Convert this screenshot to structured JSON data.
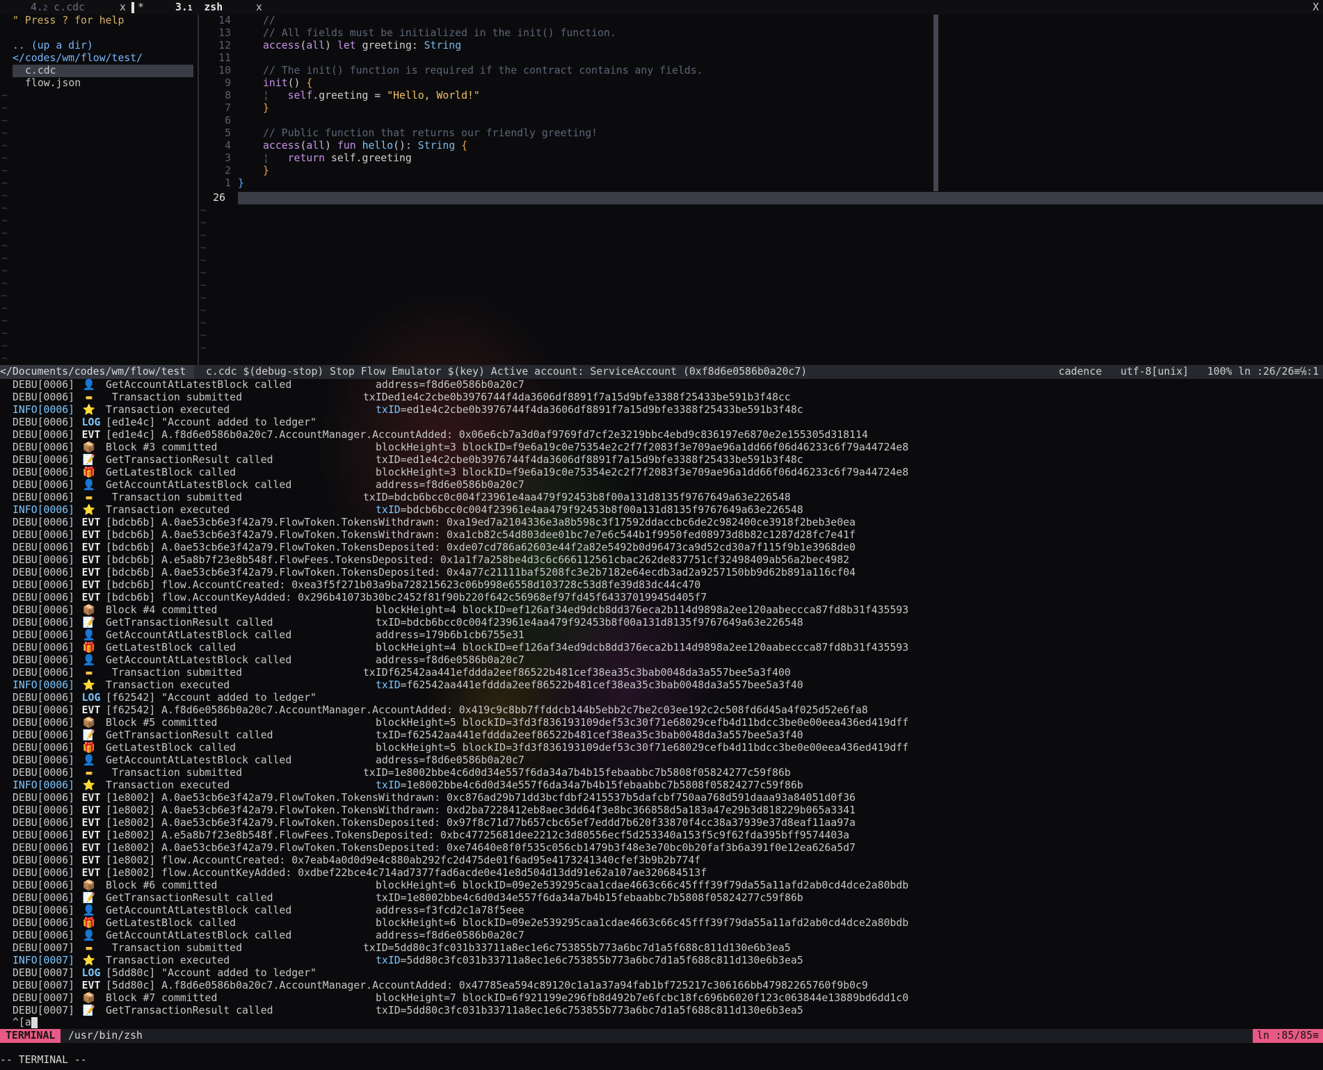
{
  "tabline": {
    "tabs": [
      {
        "num": "4.",
        "sub": "2",
        "label": "c.cdc",
        "close": "x",
        "active": false
      },
      {
        "num": "3.",
        "sub": "1",
        "label": "zsh",
        "close": "x",
        "active": true
      }
    ],
    "modified_marker": "*",
    "right_close": "X"
  },
  "nerdtree": {
    "help": "\" Press ? for help",
    "up_dir": ".. (up a dir)",
    "root": "</codes/wm/flow/test/",
    "files": [
      "c.cdc",
      "flow.json"
    ],
    "tilde": "~"
  },
  "editor": {
    "lines": [
      {
        "n": "14",
        "text": "//"
      },
      {
        "n": "13",
        "text": "// All fields must be initialized in the init() function."
      },
      {
        "n": "12",
        "text": "access(all) let greeting: String"
      },
      {
        "n": "11",
        "text": ""
      },
      {
        "n": "10",
        "text": "// The init() function is required if the contract contains any fields."
      },
      {
        "n": "9",
        "text": "init() {"
      },
      {
        "n": "8",
        "text": "self.greeting = \"Hello, World!\""
      },
      {
        "n": "7",
        "text": "}"
      },
      {
        "n": "6",
        "text": ""
      },
      {
        "n": "5",
        "text": "// Public function that returns our friendly greeting!"
      },
      {
        "n": "4",
        "text": "access(all) fun hello(): String {"
      },
      {
        "n": "3",
        "text": "return self.greeting"
      },
      {
        "n": "2",
        "text": "}"
      },
      {
        "n": "1",
        "text": "}"
      }
    ],
    "current_line": "26"
  },
  "statusline": {
    "left": "</Documents/codes/wm/flow/test",
    "file": "c.cdc",
    "middle": "$(debug-stop) Stop Flow Emulator $(key) Active account: ServiceAccount (0xf8d6e0586b0a20c7)",
    "filetype": "cadence",
    "encoding": "utf-8[unix]",
    "percent": "100%",
    "position": "ln :26/26≡℅:1"
  },
  "log": [
    {
      "lvl": "DEBU[0006]",
      "ic": "👤",
      "icc": "blue",
      "msg": "GetAccountAtLatestBlock called",
      "det": "address=f8d6e0586b0a20c7"
    },
    {
      "lvl": "DEBU[0006]",
      "ic": "▬",
      "icc": "yellow",
      "msg": " Transaction submitted",
      "det": "txIDed1e4c2cbe0b3976744f4da3606df8891f7a15d9bfe3388f25433be591b3f48cc",
      "sub": true
    },
    {
      "lvl": "INFO[0006]",
      "ic": "⭐",
      "icc": "yellow",
      "msg": "Transaction executed",
      "det": "txID=ed1e4c2cbe0b3976744f4da3606df8891f7a15d9bfe3388f25433be591b3f48c",
      "hl": true
    },
    {
      "lvl": "DEBU[0006]",
      "tag": "LOG",
      "msg": "[ed1e4c] \"Account added to ledger\""
    },
    {
      "lvl": "DEBU[0006]",
      "tag": "EVT",
      "msg": "[ed1e4c] A.f8d6e0586b0a20c7.AccountManager.AccountAdded: 0x06e6cb7a3d0af9769fd7cf2e3219bbc4ebd9c836197e6870e2e155305d318114"
    },
    {
      "lvl": "DEBU[0006]",
      "ic": "📦",
      "icc": "brown",
      "msg": "Block #3 committed",
      "det": "blockHeight=3 blockID=f9e6a19c0e75354e2c2f7f2083f3e709ae96a1dd66f06d46233c6f79a44724e8"
    },
    {
      "lvl": "DEBU[0006]",
      "ic": "📝",
      "icc": "white",
      "msg": "GetTransactionResult called",
      "det": "txID=ed1e4c2cbe0b3976744f4da3606df8891f7a15d9bfe3388f25433be591b3f48c"
    },
    {
      "lvl": "DEBU[0006]",
      "ic": "🎁",
      "icc": "cyan",
      "msg": "GetLatestBlock called",
      "det": "blockHeight=3 blockID=f9e6a19c0e75354e2c2f7f2083f3e709ae96a1dd66f06d46233c6f79a44724e8"
    },
    {
      "lvl": "DEBU[0006]",
      "ic": "👤",
      "icc": "blue",
      "msg": "GetAccountAtLatestBlock called",
      "det": "address=f8d6e0586b0a20c7"
    },
    {
      "lvl": "DEBU[0006]",
      "ic": "▬",
      "icc": "yellow",
      "msg": " Transaction submitted",
      "det": "txID=bdcb6bcc0c004f23961e4aa479f92453b8f00a131d8135f9767649a63e226548",
      "sub": true
    },
    {
      "lvl": "INFO[0006]",
      "ic": "⭐",
      "icc": "yellow",
      "msg": "Transaction executed",
      "det": "txID=bdcb6bcc0c004f23961e4aa479f92453b8f00a131d8135f9767649a63e226548",
      "hl": true
    },
    {
      "lvl": "DEBU[0006]",
      "tag": "EVT",
      "msg": "[bdcb6b] A.0ae53cb6e3f42a79.FlowToken.TokensWithdrawn: 0xa19ed7a2104336e3a8b598c3f17592ddaccbc6de2c982400ce3918f2beb3e0ea"
    },
    {
      "lvl": "DEBU[0006]",
      "tag": "EVT",
      "msg": "[bdcb6b] A.0ae53cb6e3f42a79.FlowToken.TokensWithdrawn: 0xa1cb82c54d803dee01bc7e7e6c544b1f9950fed08973d8b82c1287d28fc7e41f"
    },
    {
      "lvl": "DEBU[0006]",
      "tag": "EVT",
      "msg": "[bdcb6b] A.0ae53cb6e3f42a79.FlowToken.TokensDeposited: 0xde07cd786a62603e44f2a82e5492b0d96473ca9d52cd30a7f115f9b1e3968de0"
    },
    {
      "lvl": "DEBU[0006]",
      "tag": "EVT",
      "msg": "[bdcb6b] A.e5a8b7f23e8b548f.FlowFees.TokensDeposited: 0x1a1f7a258be4d3c6c666112561cbac262de837751cf32498409ab56a2bec4982"
    },
    {
      "lvl": "DEBU[0006]",
      "tag": "EVT",
      "msg": "[bdcb6b] A.0ae53cb6e3f42a79.FlowToken.TokensDeposited: 0x4a77c21111baf5208fc3e2b7182e64ecdb3ad2a9257150bb9d62b891a116cf04"
    },
    {
      "lvl": "DEBU[0006]",
      "tag": "EVT",
      "msg": "[bdcb6b] flow.AccountCreated: 0xea3f5f271b03a9ba728215623c06b998e6558d103728c53d8fe39d83dc44c470"
    },
    {
      "lvl": "DEBU[0006]",
      "tag": "EVT",
      "msg": "[bdcb6b] flow.AccountKeyAdded: 0x296b41073b30bc2452f81f90b220f642c56968ef97fd45f64337019945d405f7"
    },
    {
      "lvl": "DEBU[0006]",
      "ic": "📦",
      "icc": "brown",
      "msg": "Block #4 committed",
      "det": "blockHeight=4 blockID=ef126af34ed9dcb8dd376eca2b114d9898a2ee120aabeccca87fd8b31f435593"
    },
    {
      "lvl": "DEBU[0006]",
      "ic": "📝",
      "icc": "white",
      "msg": "GetTransactionResult called",
      "det": "txID=bdcb6bcc0c004f23961e4aa479f92453b8f00a131d8135f9767649a63e226548"
    },
    {
      "lvl": "DEBU[0006]",
      "ic": "👤",
      "icc": "blue",
      "msg": "GetAccountAtLatestBlock called",
      "det": "address=179b6b1cb6755e31"
    },
    {
      "lvl": "DEBU[0006]",
      "ic": "🎁",
      "icc": "cyan",
      "msg": "GetLatestBlock called",
      "det": "blockHeight=4 blockID=ef126af34ed9dcb8dd376eca2b114d9898a2ee120aabeccca87fd8b31f435593"
    },
    {
      "lvl": "DEBU[0006]",
      "ic": "👤",
      "icc": "blue",
      "msg": "GetAccountAtLatestBlock called",
      "det": "address=f8d6e0586b0a20c7"
    },
    {
      "lvl": "DEBU[0006]",
      "ic": "▬",
      "icc": "yellow",
      "msg": " Transaction submitted",
      "det": "txIDf62542aa441efddda2eef86522b481cef38ea35c3bab0048da3a557bee5a3f400",
      "sub": true
    },
    {
      "lvl": "INFO[0006]",
      "ic": "⭐",
      "icc": "yellow",
      "msg": "Transaction executed",
      "det": "txID=f62542aa441efddda2eef86522b481cef38ea35c3bab0048da3a557bee5a3f40",
      "hl": true
    },
    {
      "lvl": "DEBU[0006]",
      "tag": "LOG",
      "msg": "[f62542] \"Account added to ledger\""
    },
    {
      "lvl": "DEBU[0006]",
      "tag": "EVT",
      "msg": "[f62542] A.f8d6e0586b0a20c7.AccountManager.AccountAdded: 0x419c9c8bb7ffddcb144b5ebb2c7be2c03ee192c2c508fd6d45a4f025d52e6fa8"
    },
    {
      "lvl": "DEBU[0006]",
      "ic": "📦",
      "icc": "brown",
      "msg": "Block #5 committed",
      "det": "blockHeight=5 blockID=3fd3f836193109def53c30f71e68029cefb4d11bdcc3be0e00eea436ed419dff"
    },
    {
      "lvl": "DEBU[0006]",
      "ic": "📝",
      "icc": "white",
      "msg": "GetTransactionResult called",
      "det": "txID=f62542aa441efddda2eef86522b481cef38ea35c3bab0048da3a557bee5a3f40"
    },
    {
      "lvl": "DEBU[0006]",
      "ic": "🎁",
      "icc": "cyan",
      "msg": "GetLatestBlock called",
      "det": "blockHeight=5 blockID=3fd3f836193109def53c30f71e68029cefb4d11bdcc3be0e00eea436ed419dff"
    },
    {
      "lvl": "DEBU[0006]",
      "ic": "👤",
      "icc": "blue",
      "msg": "GetAccountAtLatestBlock called",
      "det": "address=f8d6e0586b0a20c7"
    },
    {
      "lvl": "DEBU[0006]",
      "ic": "▬",
      "icc": "yellow",
      "msg": " Transaction submitted",
      "det": "txID=1e8002bbe4c6d0d34e557f6da34a7b4b15febaabbc7b5808f05824277c59f86b",
      "sub": true
    },
    {
      "lvl": "INFO[0006]",
      "ic": "⭐",
      "icc": "yellow",
      "msg": "Transaction executed",
      "det": "txID=1e8002bbe4c6d0d34e557f6da34a7b4b15febaabbc7b5808f05824277c59f86b",
      "hl": true
    },
    {
      "lvl": "DEBU[0006]",
      "tag": "EVT",
      "msg": "[1e8002] A.0ae53cb6e3f42a79.FlowToken.TokensWithdrawn: 0xc876ad29b71dd3bcfdbf2415537b5dafcbf750aa768d591daaa93a84051d0f36"
    },
    {
      "lvl": "DEBU[0006]",
      "tag": "EVT",
      "msg": "[1e8002] A.0ae53cb6e3f42a79.FlowToken.TokensWithdrawn: 0xd2ba7228412eb8aec3dd64f3e8bc366858d5a183a47e29b3d818229b065a3341"
    },
    {
      "lvl": "DEBU[0006]",
      "tag": "EVT",
      "msg": "[1e8002] A.0ae53cb6e3f42a79.FlowToken.TokensDeposited: 0x97f8c71d77b657cbc65ef7eddd7b620f33870f4cc38a37939e37d8eaf11aa97a"
    },
    {
      "lvl": "DEBU[0006]",
      "tag": "EVT",
      "msg": "[1e8002] A.e5a8b7f23e8b548f.FlowFees.TokensDeposited: 0xbc47725681dee2212c3d80556ecf5d253340a153f5c9f62fda395bff9574403a"
    },
    {
      "lvl": "DEBU[0006]",
      "tag": "EVT",
      "msg": "[1e8002] A.0ae53cb6e3f42a79.FlowToken.TokensDeposited: 0xe74640e8f0f535c056cb1479b3f48e3e70bc0b20faf3b6a391f0e12ea626a5d7"
    },
    {
      "lvl": "DEBU[0006]",
      "tag": "EVT",
      "msg": "[1e8002] flow.AccountCreated: 0x7eab4a0d0d9e4c880ab292fc2d475de01f6ad95e4173241340cfef3b9b2b774f"
    },
    {
      "lvl": "DEBU[0006]",
      "tag": "EVT",
      "msg": "[1e8002] flow.AccountKeyAdded: 0xdbef22bce4c714ad7377fad6acde0e41e8d504d13dd91e62a107ae320684513f"
    },
    {
      "lvl": "DEBU[0006]",
      "ic": "📦",
      "icc": "brown",
      "msg": "Block #6 committed",
      "det": "blockHeight=6 blockID=09e2e539295caa1cdae4663c66c45fff39f79da55a11afd2ab0cd4dce2a80bdb"
    },
    {
      "lvl": "DEBU[0006]",
      "ic": "📝",
      "icc": "white",
      "msg": "GetTransactionResult called",
      "det": "txID=1e8002bbe4c6d0d34e557f6da34a7b4b15febaabbc7b5808f05824277c59f86b"
    },
    {
      "lvl": "DEBU[0006]",
      "ic": "👤",
      "icc": "blue",
      "msg": "GetAccountAtLatestBlock called",
      "det": "address=f3fcd2c1a78f5eee"
    },
    {
      "lvl": "DEBU[0006]",
      "ic": "🎁",
      "icc": "cyan",
      "msg": "GetLatestBlock called",
      "det": "blockHeight=6 blockID=09e2e539295caa1cdae4663c66c45fff39f79da55a11afd2ab0cd4dce2a80bdb"
    },
    {
      "lvl": "DEBU[0006]",
      "ic": "👤",
      "icc": "blue",
      "msg": "GetAccountAtLatestBlock called",
      "det": "address=f8d6e0586b0a20c7"
    },
    {
      "lvl": "DEBU[0007]",
      "ic": "▬",
      "icc": "yellow",
      "msg": " Transaction submitted",
      "det": "txID=5dd80c3fc031b33711a8ec1e6c753855b773a6bc7d1a5f688c811d130e6b3ea5",
      "sub": true
    },
    {
      "lvl": "INFO[0007]",
      "ic": "⭐",
      "icc": "yellow",
      "msg": "Transaction executed",
      "det": "txID=5dd80c3fc031b33711a8ec1e6c753855b773a6bc7d1a5f688c811d130e6b3ea5",
      "hl": true
    },
    {
      "lvl": "DEBU[0007]",
      "tag": "LOG",
      "msg": "[5dd80c] \"Account added to ledger\""
    },
    {
      "lvl": "DEBU[0007]",
      "tag": "EVT",
      "msg": "[5dd80c] A.f8d6e0586b0a20c7.AccountManager.AccountAdded: 0x47785ea594c89120c1a1a37a94fab1bf725217c306166bb47982265760f9b0c9"
    },
    {
      "lvl": "DEBU[0007]",
      "ic": "📦",
      "icc": "brown",
      "msg": "Block #7 committed",
      "det": "blockHeight=7 blockID=6f921199e296fb8d492b7e6fcbc18fc696b6020f123c063844e13889bd6dd1c0"
    },
    {
      "lvl": "DEBU[0007]",
      "ic": "📝",
      "icc": "white",
      "msg": "GetTransactionResult called",
      "det": "txID=5dd80c3fc031b33711a8ec1e6c753855b773a6bc7d1a5f688c811d130e6b3ea5"
    }
  ],
  "prompt": "^[a",
  "terminal_status": {
    "mode": "TERMINAL",
    "shell": "/usr/bin/zsh",
    "position": "ln :85/85≡"
  },
  "modeline": "-- TERMINAL --"
}
